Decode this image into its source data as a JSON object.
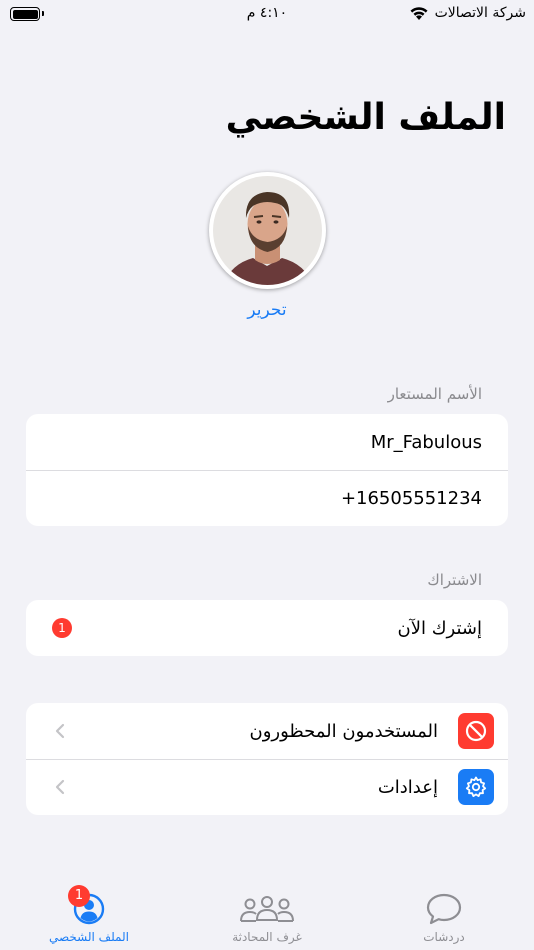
{
  "status_bar": {
    "time": "٤:١٠ م",
    "carrier": "شركة الاتصالات",
    "battery_level": 1.0
  },
  "header": {
    "title": "الملف الشخصي"
  },
  "profile": {
    "edit_label": "تحرير"
  },
  "nickname_section": {
    "header": "الأسم المستعار",
    "username": "Mr_Fabulous",
    "phone": "+16505551234"
  },
  "subscription_section": {
    "header": "الاشتراك",
    "subscribe_label": "إشترك الآن",
    "badge_count": "1"
  },
  "settings_section": {
    "items": [
      {
        "label": "المستخدمون المحظورون",
        "icon": "blocked-icon",
        "icon_color": "#ff3b30"
      },
      {
        "label": "إعدادات",
        "icon": "gear-icon",
        "icon_color": "#1a7cf5"
      }
    ]
  },
  "tab_bar": {
    "tabs": [
      {
        "label": "دردشات",
        "icon": "chat-bubble-icon",
        "active": false
      },
      {
        "label": "غرف المحادثة",
        "icon": "group-icon",
        "active": false
      },
      {
        "label": "الملف الشخصي",
        "icon": "profile-icon",
        "active": true,
        "badge": "1"
      }
    ]
  },
  "colors": {
    "accent": "#1a7cf5",
    "badge": "#ff3b30",
    "background": "#f2f2f7"
  }
}
